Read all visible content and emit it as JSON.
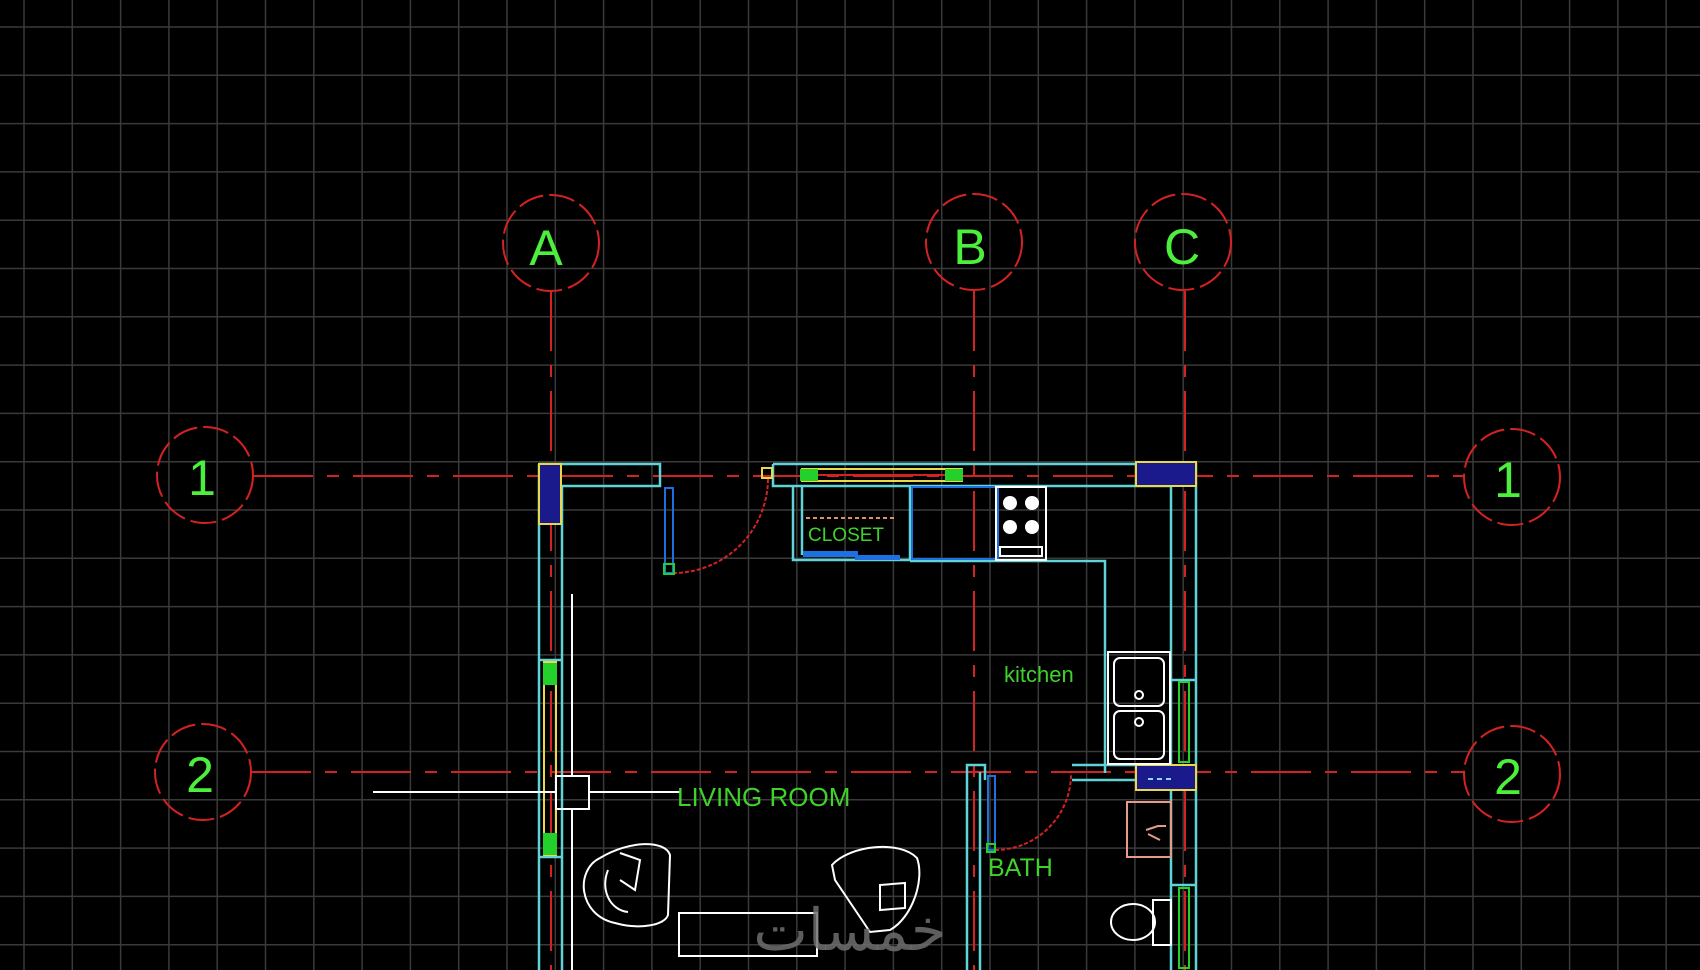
{
  "app": {
    "name": "CAD floor plan viewport",
    "background": "#000000"
  },
  "colors": {
    "grid": "#3a3a3a",
    "axis": "#d42222",
    "axis_label": "#4cf03c",
    "wall": "#5fd3d8",
    "room_label": "#3ed22a",
    "furniture": "#ffffff",
    "window_frame": "#e8d84a",
    "window_glass": "#23d12a",
    "column_fill": "#1a1a8c",
    "cabinet_blue": "#1e6fe0",
    "sink_pink": "#e89a8a",
    "watermark": "#6e6e6e"
  },
  "grid_axes": {
    "columns": [
      {
        "label": "A"
      },
      {
        "label": "B"
      },
      {
        "label": "C"
      }
    ],
    "rows": [
      {
        "label": "1"
      },
      {
        "label": "1"
      },
      {
        "label": "2"
      },
      {
        "label": "2"
      }
    ]
  },
  "rooms": {
    "closet": "CLOSET",
    "kitchen": "kitchen",
    "living_room": "LIVING ROOM",
    "bath": "BATH"
  },
  "fixtures": [
    "stove",
    "double-sink",
    "washbasin",
    "toilet",
    "armchair",
    "armchair",
    "coffee-table"
  ],
  "watermark": "خمسات",
  "cursor": {
    "type": "crosshair"
  }
}
